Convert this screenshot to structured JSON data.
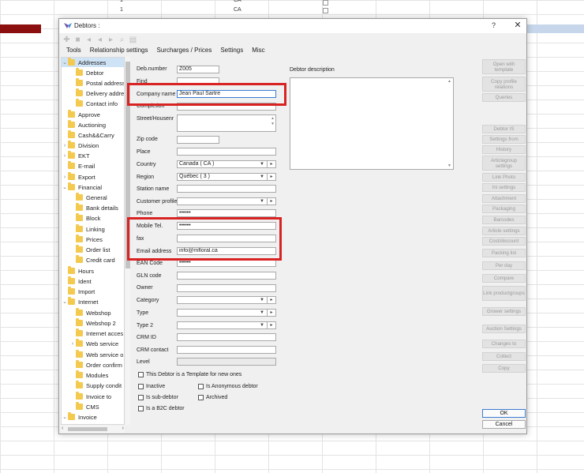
{
  "sheet": {
    "top_values": [
      "1",
      "CA",
      "1",
      "CA"
    ]
  },
  "dialog": {
    "title": "Debtors :",
    "help_label": "?",
    "close_label": "✕",
    "menu": [
      "Tools",
      "Relationship settings",
      "Surcharges / Prices",
      "Settings",
      "Misc"
    ],
    "toolbar_icons": [
      "add-icon",
      "delete-icon",
      "back-icon",
      "forward-icon",
      "next-icon",
      "search-icon",
      "document-icon"
    ]
  },
  "tree": {
    "addresses": "Addresses",
    "debtor": "Debtor",
    "postal_address": "Postal address",
    "delivery_address": "Delivery addre",
    "contact_info": "Contact info",
    "approve": "Approve",
    "auctioning": "Auctioning",
    "cash_carry": "Cash&&Carry",
    "division": "Division",
    "ekt": "EKT",
    "email": "E-mail",
    "export": "Export",
    "financial": "Financial",
    "general": "General",
    "bank_details": "Bank details",
    "block": "Block",
    "linking": "Linking",
    "prices": "Prices",
    "order_list": "Order list",
    "credit_card": "Credit card",
    "hours": "Hours",
    "ident": "Ident",
    "import": "Import",
    "internet": "Internet",
    "webshop": "Webshop",
    "webshop2": "Webshop 2",
    "internet_access": "Internet acces",
    "web_service": "Web service",
    "web_service_o": "Web service o",
    "order_confirm": "Order confirm",
    "modules": "Modules",
    "supply_cond": "Supply condit",
    "invoice_to": "Invoice to",
    "cms": "CMS",
    "invoice": "Invoice"
  },
  "form": {
    "deb_number_label": "Deb.number",
    "deb_number": "Z005",
    "find_label": "Find",
    "find": "",
    "company_label": "Company name",
    "company": "Jean Paul Sartre",
    "completion_label": "Completion",
    "completion": "",
    "street_label": "Street/Housenr",
    "street": "",
    "zip_label": "Zip code",
    "zip": "",
    "place_label": "Place",
    "place": "",
    "country_label": "Country",
    "country": "Canada  ( CA )",
    "region_label": "Region",
    "region": "Québec  ( 3 )",
    "station_label": "Station name",
    "station": "",
    "customer_profile_label": "Customer profile",
    "customer_profile": "",
    "phone_label": "Phone",
    "phone": "••••••",
    "mobile_label": "Mobile Tel.",
    "mobile": "••••••",
    "fax_label": "fax",
    "fax": "",
    "email_label": "Email address",
    "email": "info@mfloral.ca",
    "ean_label": "EAN Code",
    "ean": "••••••",
    "gln_label": "GLN code",
    "gln": "",
    "owner_label": "Owner",
    "owner": "",
    "category_label": "Category",
    "category": "",
    "type_label": "Type",
    "type": "",
    "type2_label": "Type 2",
    "type2": "",
    "crm_id_label": "CRM ID",
    "crm_id": "",
    "crm_contact_label": "CRM contact",
    "crm_contact": "",
    "level_label": "Level",
    "level": "",
    "template_chk": "This Debtor is a Template for new ones",
    "inactive_chk": "Inactive",
    "anonymous_chk": "Is Anonymous debtor",
    "subdebtor_chk": "Is sub-debtor",
    "archived_chk": "Archived",
    "b2c_chk": "Is a B2C debtor",
    "description_label": "Debtor description"
  },
  "side_buttons": {
    "open_template": "Open with template",
    "copy_profile": "Copy profile relations",
    "queries": "Queries",
    "debtor_is": "Debtor IS",
    "settings_from": "Settings from",
    "history": "History",
    "articlegroup_settings": "Articlegroup settings",
    "link_photo": "Link Photo",
    "ini_settings": "Ini settings",
    "attachment": "Attachment",
    "packaging": "Packaging",
    "barcodes": "Barcodes",
    "article_settings": "Article settings",
    "cost_discount": "Cost/discount",
    "packing_list": "Packing list",
    "per_day": "Per day",
    "compare": "Compare",
    "link_productgroups": "Link productgroups",
    "grower_settings": "Grower settings",
    "auction_settings": "Auction Settings",
    "changes_to": "Changes to",
    "collect": "Collect",
    "copy": "Copy",
    "ok": "OK",
    "cancel": "Cancel"
  },
  "colors": {
    "highlight": "#d92323",
    "folder": "#f4c94f",
    "selection": "#cfe3f7"
  }
}
